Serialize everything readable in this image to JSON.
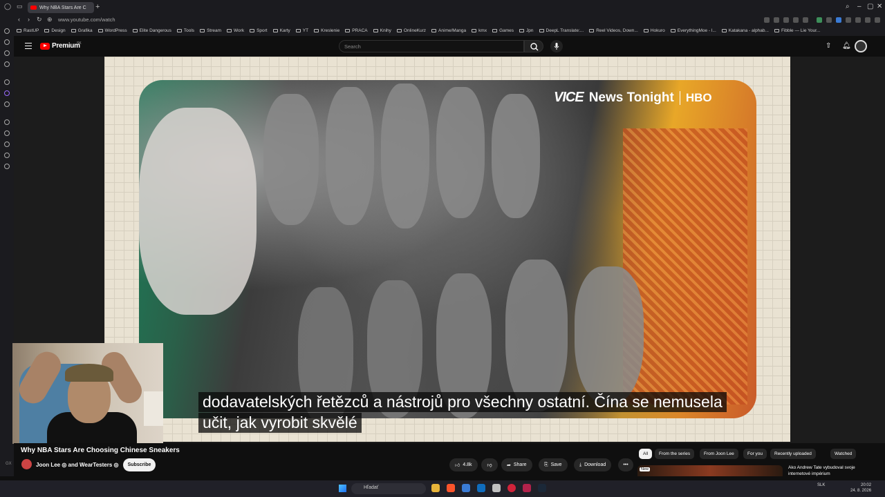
{
  "browser": {
    "tab_title": "Why NBA Stars Are Cho",
    "new_tab": "+",
    "url": "www.youtube.com/watch",
    "bookmarks": [
      "RastUP",
      "Design",
      "Grafika",
      "WordPress",
      "Elite Dangerous",
      "Tools",
      "Stream",
      "Work",
      "Sport",
      "Karty",
      "YT",
      "Kreslenie",
      "PRACA",
      "Knihy",
      "OnlineKurz",
      "Anime/Manga",
      "kmx",
      "Games",
      "Jpn",
      "DeepL Translate:...",
      "Reel Videos, Down...",
      "Hokuro",
      "EverythingMoe - l...",
      "Katakana - alphab...",
      "Fibble — Lie Your..."
    ]
  },
  "youtube": {
    "logo_text": "Premium",
    "logo_region": "SK",
    "search_placeholder": "Search"
  },
  "video": {
    "overlay_brand": "VICE",
    "overlay_show": "News Tonight",
    "overlay_network": "HBO",
    "caption_line1": "dodavatelských řetězců a nástrojů pro všechny ostatní.  Čína se nemusela",
    "caption_line2": "učit, jak vyrobit skvělé",
    "title": "Why NBA Stars Are Choosing Chinese Sneakers",
    "channel": "Joon Lee ◎ and WearTesters ◎",
    "subscribe": "Subscribe",
    "likes": "4.8k",
    "share": "Share",
    "save": "Save",
    "download": "Download",
    "more": "•••"
  },
  "chips": [
    "All",
    "From the series",
    "From Joon Lee",
    "For you",
    "Recently uploaded",
    "Watched"
  ],
  "recommended": {
    "badge": "New",
    "title": "Ako Andrew Tate vybudoval svoje internetové impérium"
  },
  "taskbar": {
    "search": "Hľadať",
    "lang": "SLK",
    "time": "20:02",
    "date": "24. 8. 2026"
  },
  "sidebar_tag": "GX"
}
